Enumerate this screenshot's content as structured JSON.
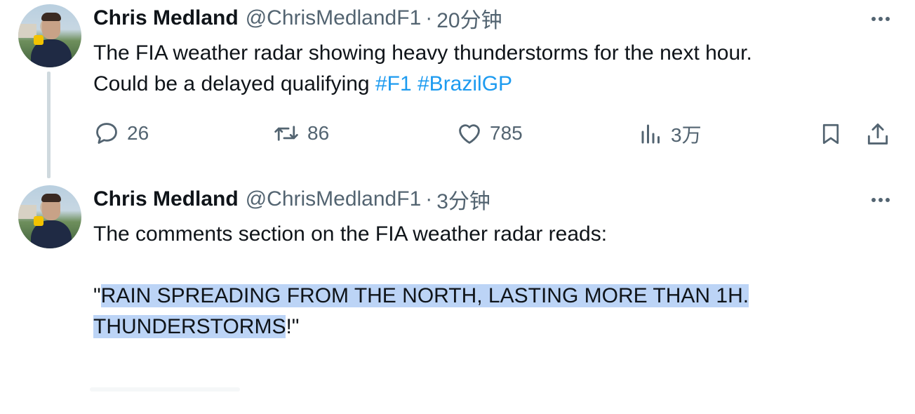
{
  "tweets": [
    {
      "author_name": "Chris Medland",
      "handle": "@ChrisMedlandF1",
      "separator": "·",
      "time": "20分钟",
      "text_line1": "The FIA weather radar showing heavy thunderstorms for the next hour.",
      "text_line2_prefix": "Could be a delayed qualifying ",
      "hashtags": [
        "#F1",
        "#BrazilGP"
      ],
      "actions": {
        "replies": "26",
        "retweets": "86",
        "likes": "785",
        "views": "3万"
      }
    },
    {
      "author_name": "Chris Medland",
      "handle": "@ChrisMedlandF1",
      "separator": "·",
      "time": "3分钟",
      "text_line1": "The comments section on the FIA weather radar reads:",
      "quote_open": "\"",
      "quote_line1": "RAIN SPREADING FROM THE NORTH, LASTING MORE THAN 1H.",
      "quote_line2": "THUNDERSTORMS",
      "quote_close": "!\""
    }
  ],
  "colors": {
    "accent": "#1d9bf0",
    "secondary_text": "#536471",
    "selection": "#bcd4f6",
    "thread_line": "#cfd9de"
  }
}
